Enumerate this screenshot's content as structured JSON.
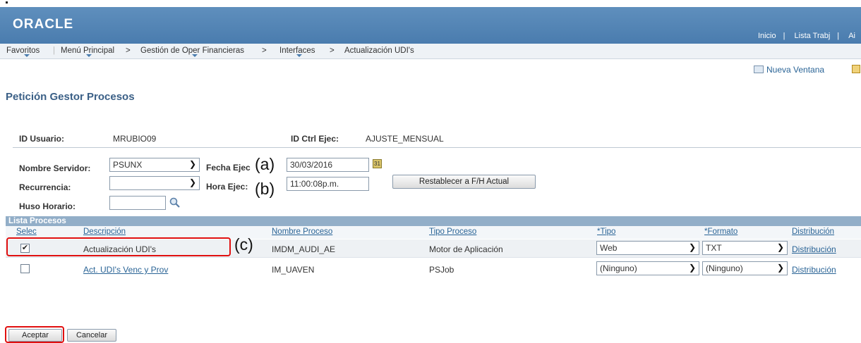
{
  "header": {
    "logo": "ORACLE",
    "links": [
      "Inicio",
      "Lista Trabj",
      "Ai"
    ]
  },
  "nav": {
    "items": [
      "Favoritos",
      "Menú Principal",
      "Gestión de Oper Financieras",
      "Interfaces",
      "Actualización UDI's"
    ],
    "separator": ">"
  },
  "toolbar": {
    "new_window": "Nueva Ventana"
  },
  "page": {
    "title": "Petición Gestor Procesos"
  },
  "form": {
    "user_id_label": "ID Usuario:",
    "user_id": "MRUBIO09",
    "run_ctrl_label": "ID Ctrl Ejec:",
    "run_ctrl": "AJUSTE_MENSUAL",
    "server_label": "Nombre Servidor:",
    "server": "PSUNX",
    "run_date_label": "Fecha Ejec",
    "run_date": "30/03/2016",
    "recurrence_label": "Recurrencia:",
    "recurrence": "",
    "run_time_label": "Hora Ejec:",
    "run_time": "11:00:08p.m.",
    "timezone_label": "Huso Horario:",
    "timezone": "",
    "reset_button": "Restablecer a F/H Actual"
  },
  "annotations": {
    "a": "(a)",
    "b": "(b)",
    "c": "(c)"
  },
  "process_list": {
    "title": "Lista Procesos",
    "columns": [
      "Selec",
      "Descripción",
      "Nombre Proceso",
      "Tipo Proceso",
      "*Tipo",
      "*Formato",
      "Distribución"
    ],
    "rows": [
      {
        "selected": true,
        "description": "Actualización UDI's",
        "process_name": "IMDM_AUDI_AE",
        "process_type": "Motor de Aplicación",
        "type": "Web",
        "format": "TXT",
        "distribution": "Distribución"
      },
      {
        "selected": false,
        "description": "Act. UDI's Venc y Prov",
        "process_name": "IM_UAVEN",
        "process_type": "PSJob",
        "type": "(Ninguno)",
        "format": "(Ninguno)",
        "distribution": "Distribución"
      }
    ]
  },
  "footer": {
    "ok_button": "Aceptar",
    "cancel_button": "Cancelar"
  }
}
